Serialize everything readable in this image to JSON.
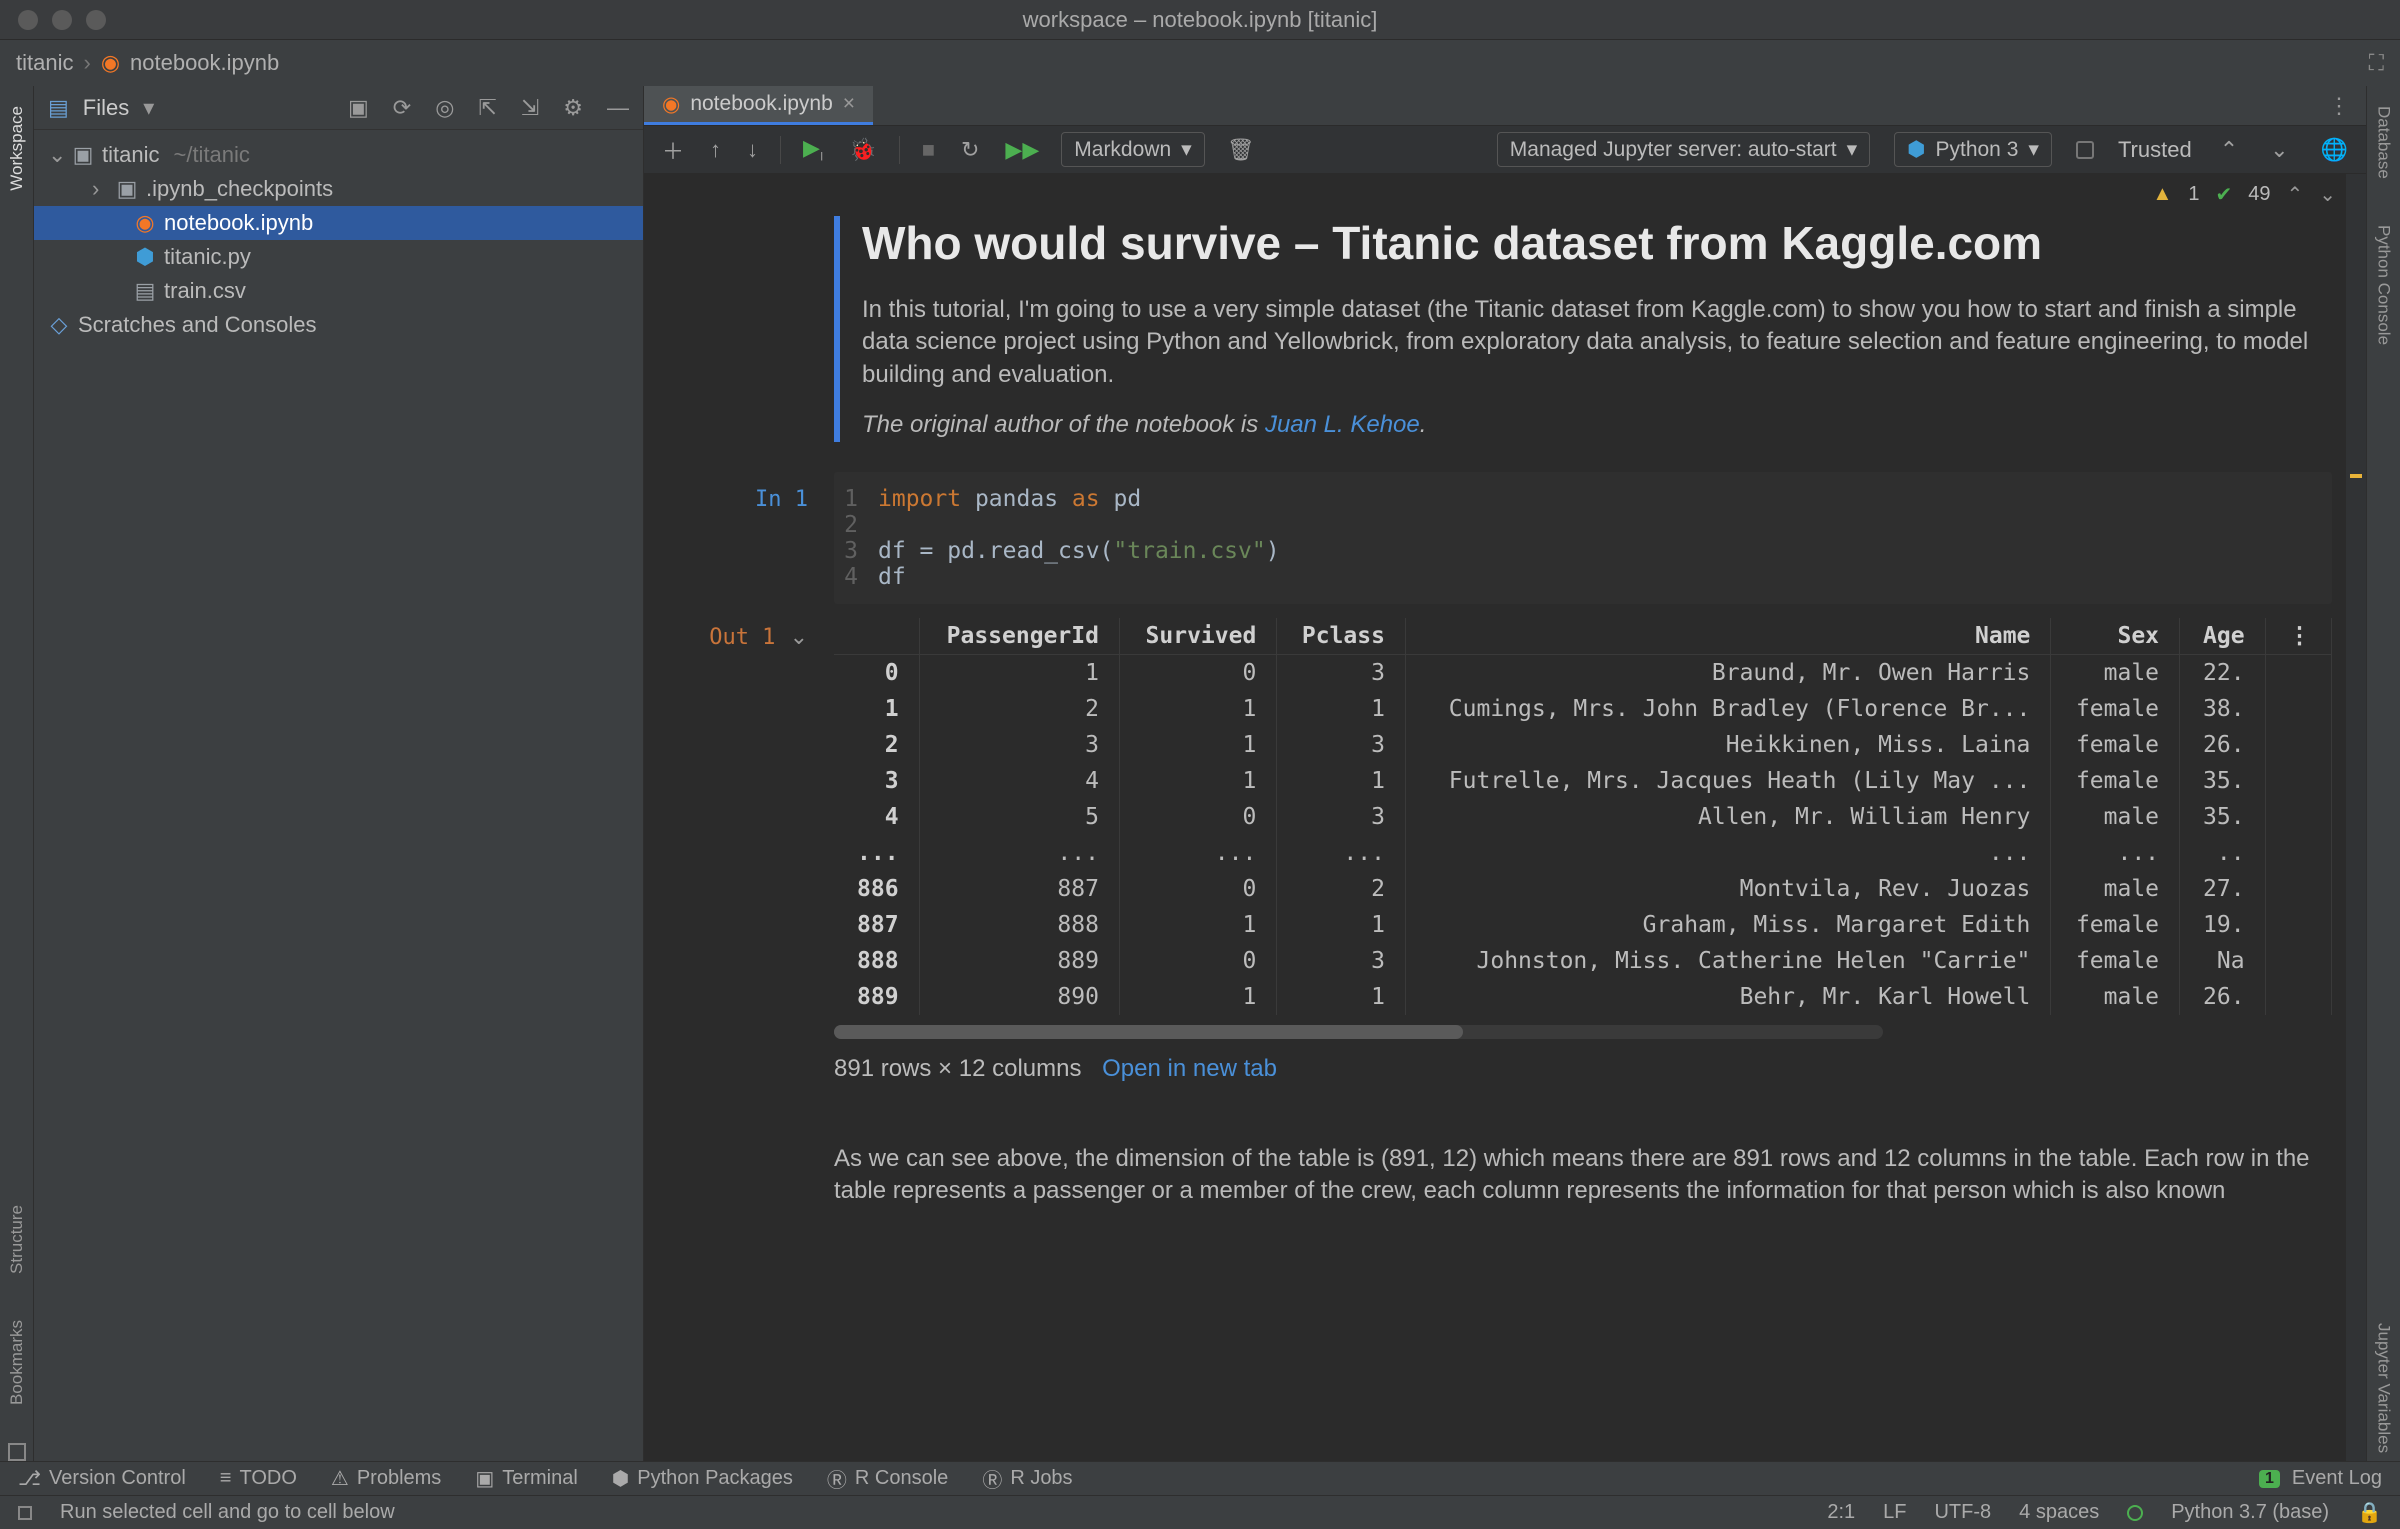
{
  "window": {
    "title": "workspace – notebook.ipynb [titanic]"
  },
  "breadcrumb": {
    "project": "titanic",
    "file": "notebook.ipynb"
  },
  "project_panel": {
    "title": "Files",
    "root": {
      "name": "titanic",
      "path": "~/titanic"
    },
    "items": [
      {
        "name": ".ipynb_checkpoints",
        "type": "folder"
      },
      {
        "name": "notebook.ipynb",
        "type": "jupyter",
        "selected": true
      },
      {
        "name": "titanic.py",
        "type": "python"
      },
      {
        "name": "train.csv",
        "type": "csv"
      }
    ],
    "scratches": "Scratches and Consoles"
  },
  "left_rail": {
    "workspace": "Workspace",
    "structure": "Structure",
    "bookmarks": "Bookmarks"
  },
  "right_rail": {
    "database": "Database",
    "python_console": "Python Console",
    "jupyter_vars": "Jupyter Variables"
  },
  "editor_tabs": {
    "active": "notebook.ipynb"
  },
  "nb_toolbar": {
    "cell_type": "Markdown",
    "server": "Managed Jupyter server: auto-start",
    "interpreter": "Python 3",
    "trusted": "Trusted"
  },
  "nb_status": {
    "warnings": "1",
    "ok": "49"
  },
  "markdown": {
    "h1": "Who would survive – Titanic dataset from Kaggle.com",
    "p1": "In this tutorial, I'm going to use a very simple dataset (the Titanic dataset from Kaggle.com) to show you how to start and finish a simple data science project using Python and Yellowbrick, from exploratory data analysis, to feature selection and feature engineering, to model building and evaluation.",
    "p2_prefix": "The original author of the notebook is ",
    "p2_link": "Juan L. Kehoe",
    "p2_suffix": "."
  },
  "code": {
    "prompt": "In 1",
    "lines": [
      {
        "n": "1",
        "html": "<span class='kw'>import</span> <span class='id'>pandas</span> <span class='kw'>as</span> <span class='id'>pd</span>"
      },
      {
        "n": "2",
        "html": ""
      },
      {
        "n": "3",
        "html": "<span class='id'>df = pd.read_csv(</span><span class='str'>\"train.csv\"</span><span class='id'>)</span>"
      },
      {
        "n": "4",
        "html": "<span class='id'>df</span>"
      }
    ]
  },
  "output": {
    "prompt": "Out 1",
    "columns": [
      "PassengerId",
      "Survived",
      "Pclass",
      "Name",
      "Sex",
      "Age"
    ],
    "rows": [
      {
        "idx": "0",
        "cells": [
          "1",
          "0",
          "3",
          "Braund, Mr. Owen Harris",
          "male",
          "22."
        ]
      },
      {
        "idx": "1",
        "cells": [
          "2",
          "1",
          "1",
          "Cumings, Mrs. John Bradley (Florence Br...",
          "female",
          "38."
        ]
      },
      {
        "idx": "2",
        "cells": [
          "3",
          "1",
          "3",
          "Heikkinen, Miss. Laina",
          "female",
          "26."
        ]
      },
      {
        "idx": "3",
        "cells": [
          "4",
          "1",
          "1",
          "Futrelle, Mrs. Jacques Heath (Lily May ...",
          "female",
          "35."
        ]
      },
      {
        "idx": "4",
        "cells": [
          "5",
          "0",
          "3",
          "Allen, Mr. William Henry",
          "male",
          "35."
        ]
      },
      {
        "idx": "...",
        "cells": [
          "...",
          "...",
          "...",
          "...",
          "...",
          ".."
        ]
      },
      {
        "idx": "886",
        "cells": [
          "887",
          "0",
          "2",
          "Montvila, Rev. Juozas",
          "male",
          "27."
        ]
      },
      {
        "idx": "887",
        "cells": [
          "888",
          "1",
          "1",
          "Graham, Miss. Margaret Edith",
          "female",
          "19."
        ]
      },
      {
        "idx": "888",
        "cells": [
          "889",
          "0",
          "3",
          "Johnston, Miss. Catherine Helen \"Carrie\"",
          "female",
          "Na"
        ]
      },
      {
        "idx": "889",
        "cells": [
          "890",
          "1",
          "1",
          "Behr, Mr. Karl Howell",
          "male",
          "26."
        ]
      }
    ],
    "summary": "891 rows × 12 columns",
    "open_link": "Open in new tab"
  },
  "below": {
    "text": "As we can see above, the dimension of the table is (891, 12) which means there are 891 rows and 12 columns in the table. Each row in the table represents a passenger or a member of the crew, each column represents the information for that person which is also known"
  },
  "bottom_tools": {
    "vcs": "Version Control",
    "todo": "TODO",
    "problems": "Problems",
    "terminal": "Terminal",
    "pypkg": "Python Packages",
    "rconsole": "R Console",
    "rjobs": "R Jobs",
    "eventlog": "Event Log",
    "event_badge": "1"
  },
  "status_bar": {
    "hint": "Run selected cell and go to cell below",
    "pos": "2:1",
    "le": "LF",
    "enc": "UTF-8",
    "indent": "4 spaces",
    "interp": "Python 3.7 (base)"
  }
}
